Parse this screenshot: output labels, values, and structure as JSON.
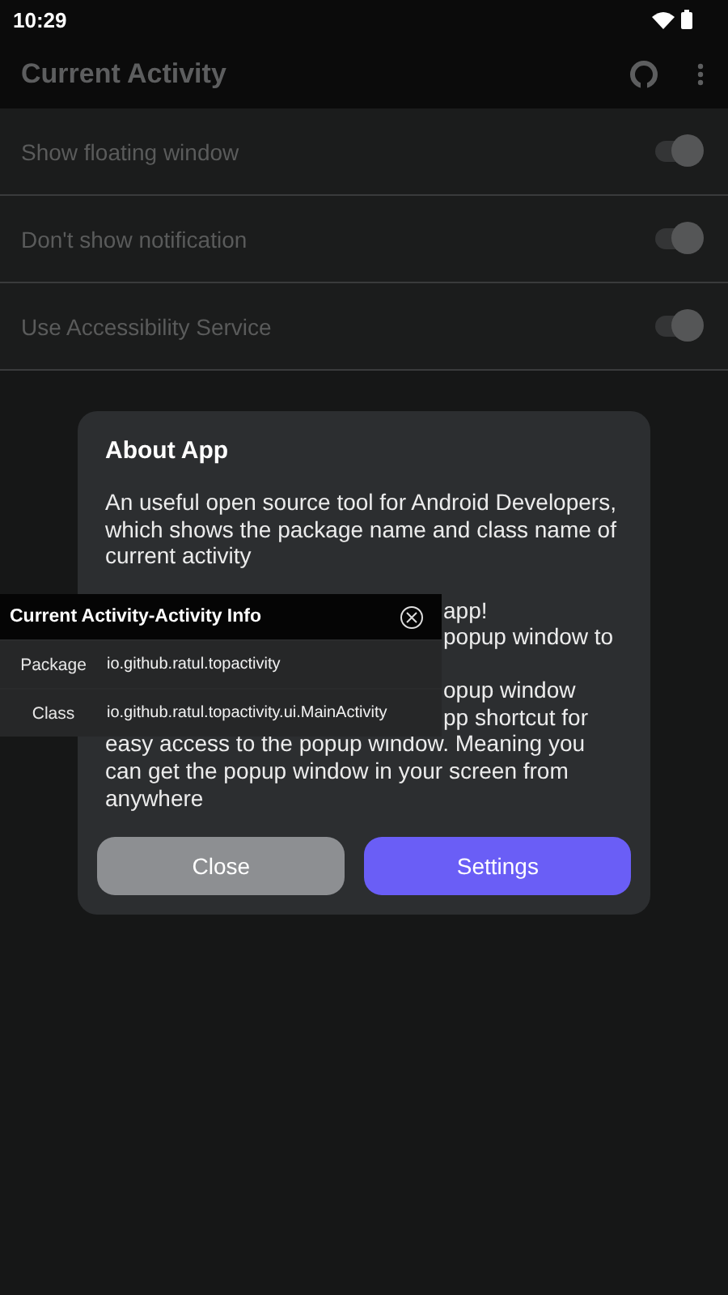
{
  "status_bar": {
    "time": "10:29"
  },
  "toolbar": {
    "title": "Current Activity"
  },
  "settings": [
    {
      "label": "Show floating window",
      "checked": true
    },
    {
      "label": "Don't show notification",
      "checked": true
    },
    {
      "label": "Use Accessibility Service",
      "checked": true
    }
  ],
  "dialog": {
    "title": "About App",
    "intro": "An useful open source tool for Android Developers, which shows the package name and class name of current activity",
    "partly_covered_lines": [
      "app!",
      "popup window to",
      "opup window",
      "pp shortcut for"
    ],
    "outro": "easy access to the popup window. Meaning you can get the popup window in your screen from anywhere",
    "buttons": [
      {
        "label": "Close",
        "kind": "secondary"
      },
      {
        "label": "Settings",
        "kind": "primary"
      }
    ]
  },
  "floating_window": {
    "title": "Current Activity-Activity Info",
    "rows": [
      {
        "label": "Package",
        "value": "io.github.ratul.topactivity"
      },
      {
        "label": "Class",
        "value": "io.github.ratul.topactivity.ui.MainActivity"
      }
    ]
  }
}
